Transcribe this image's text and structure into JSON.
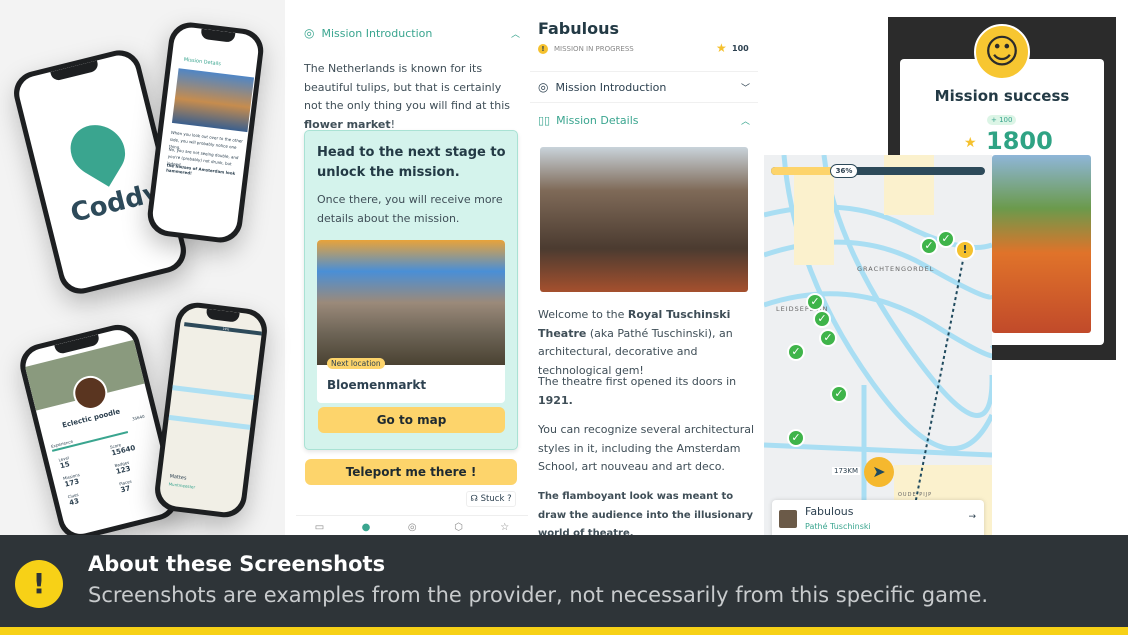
{
  "left_phones": {
    "logo_text": "Coddy",
    "details_header": "Mission Details",
    "details_text": [
      "When you look out over to the other side, you will probably notice one thing.",
      "No, you are not seeing double, and you're (probably) not drunk, but indeed...",
      "the houses of Amsterdam look hammered!"
    ],
    "profile_name": "Eclectic poodle",
    "profile_xp": "35640",
    "profile_xp_label": "Experience",
    "stats": [
      {
        "label": "Level",
        "value": "15"
      },
      {
        "label": "Score",
        "value": "15640"
      },
      {
        "label": "Missions",
        "value": "173"
      },
      {
        "label": "Badges",
        "value": "123"
      },
      {
        "label": "Clues",
        "value": "43"
      },
      {
        "label": "Places",
        "value": "37"
      }
    ],
    "map_progress": "19%",
    "map_place": "Mattes",
    "map_place_sub": "Muntmeester"
  },
  "intro_panel": {
    "header": "Mission Introduction",
    "text_plain": "The Netherlands is known for its beautiful tulips, but that is certainly not the only thing you will find at this ",
    "text_bold": "flower market",
    "text_end": "!",
    "card_title": "Head to the next stage to unlock the mission.",
    "card_sub": "Once there, you will receive more details about the mission.",
    "next_badge": "Next location",
    "location": "Bloemenmarkt",
    "go_map": "Go to map",
    "teleport": "Teleport me there !",
    "stuck": "Stuck ?"
  },
  "details_panel": {
    "title": "Fabulous",
    "status": "MISSION IN PROGRESS",
    "points": "100",
    "intro_row": "Mission Introduction",
    "details_row": "Mission Details",
    "p1_a": "Welcome to the ",
    "p1_b": "Royal Tuschinski Theatre",
    "p1_c": " (aka Pathé Tuschinski), an architectural, decorative and technological gem!",
    "p2_a": "The theatre first opened its doors in ",
    "p2_b": "1921.",
    "p3": "You can recognize several architectural styles in it, including the Amsterdam School, art nouveau and art deco.",
    "p4": "The flamboyant look was meant to draw the audience into the illusionary world of theatre."
  },
  "success": {
    "title": "Mission success",
    "bonus": "+ 100",
    "score": "1800"
  },
  "map": {
    "progress": "36%",
    "progress_value": 36,
    "label_1": "GRACHTENGORDEL",
    "label_2": "LEIDSEPLEIN",
    "label_3": "OUDE PIJP",
    "distance": "173KM",
    "card_title": "Fabulous",
    "card_sub": "Pathé Tuschinski"
  },
  "banner": {
    "title": "About these Screenshots",
    "text": "Screenshots are examples from the provider, not necessarily from this specific game.",
    "icon": "exclamation-icon",
    "accent": "#f7d117",
    "bg": "#2e3438"
  }
}
